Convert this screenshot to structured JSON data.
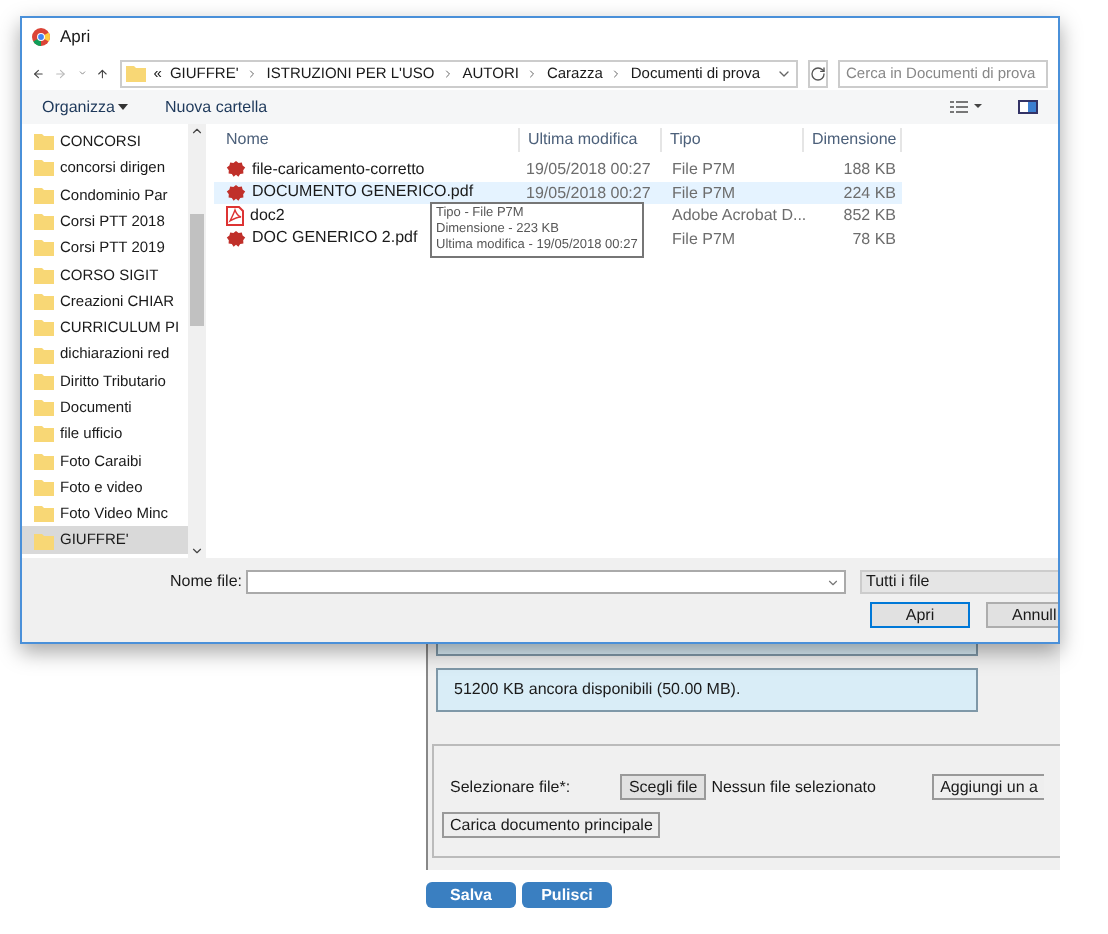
{
  "dialog": {
    "title": "Apri",
    "breadcrumb": [
      "«",
      "GIUFFRE'",
      "ISTRUZIONI PER L'USO",
      "AUTORI",
      "Carazza",
      "Documenti di prova"
    ],
    "search": {
      "placeholder": "Cerca in Documenti di prova"
    },
    "toolbar": {
      "organize": "Organizza",
      "new_folder": "Nuova cartella"
    },
    "sidebar": {
      "items": [
        {
          "label": "CONCORSI",
          "selected": false
        },
        {
          "label": "concorsi dirigen",
          "selected": false
        },
        {
          "label": "Condominio Par",
          "selected": false
        },
        {
          "label": "Corsi PTT 2018",
          "selected": false
        },
        {
          "label": "Corsi PTT 2019",
          "selected": false
        },
        {
          "label": "CORSO SIGIT",
          "selected": false
        },
        {
          "label": "Creazioni CHIAR",
          "selected": false
        },
        {
          "label": "CURRICULUM PI",
          "selected": false
        },
        {
          "label": "dichiarazioni red",
          "selected": false
        },
        {
          "label": "Diritto Tributario",
          "selected": false
        },
        {
          "label": "Documenti",
          "selected": false
        },
        {
          "label": "file ufficio",
          "selected": false
        },
        {
          "label": "Foto Caraibi",
          "selected": false
        },
        {
          "label": "Foto e video",
          "selected": false
        },
        {
          "label": "Foto Video Minc",
          "selected": false
        },
        {
          "label": "GIUFFRE'",
          "selected": true
        }
      ]
    },
    "columns": [
      "Nome",
      "Ultima modifica",
      "Tipo",
      "Dimensione"
    ],
    "files": [
      {
        "name": "file-caricamento-corretto",
        "modified": "19/05/2018 00:27",
        "type": "File P7M",
        "size": "188 KB",
        "kind": "p7m",
        "selected": false
      },
      {
        "name": "DOCUMENTO GENERICO.pdf",
        "modified": "19/05/2018 00:27",
        "type": "File P7M",
        "size": "224 KB",
        "kind": "p7m",
        "selected": true
      },
      {
        "name": "doc2",
        "type": "Adobe Acrobat D...",
        "size": "852 KB",
        "kind": "pdf",
        "selected": false
      },
      {
        "name": "DOC GENERICO 2.pdf",
        "type": "File P7M",
        "size": "78 KB",
        "kind": "p7m",
        "selected": false
      }
    ],
    "tooltip": [
      "Tipo - File P7M",
      "Dimensione - 223 KB",
      "Ultima modifica - 19/05/2018 00:27"
    ],
    "filename_label": "Nome file:",
    "file_type": "Tutti i file",
    "buttons": {
      "open": "Apri",
      "cancel": "Annull"
    }
  },
  "page": {
    "info": "51200 KB ancora disponibili (50.00 MB).",
    "select_label": "Selezionare file*:",
    "choose_button": "Scegli file",
    "no_file": "Nessun file selezionato",
    "add_button": "Aggiungi un a",
    "upload_button": "Carica documento principale",
    "actions": [
      "Salva",
      "Pulisci"
    ]
  }
}
